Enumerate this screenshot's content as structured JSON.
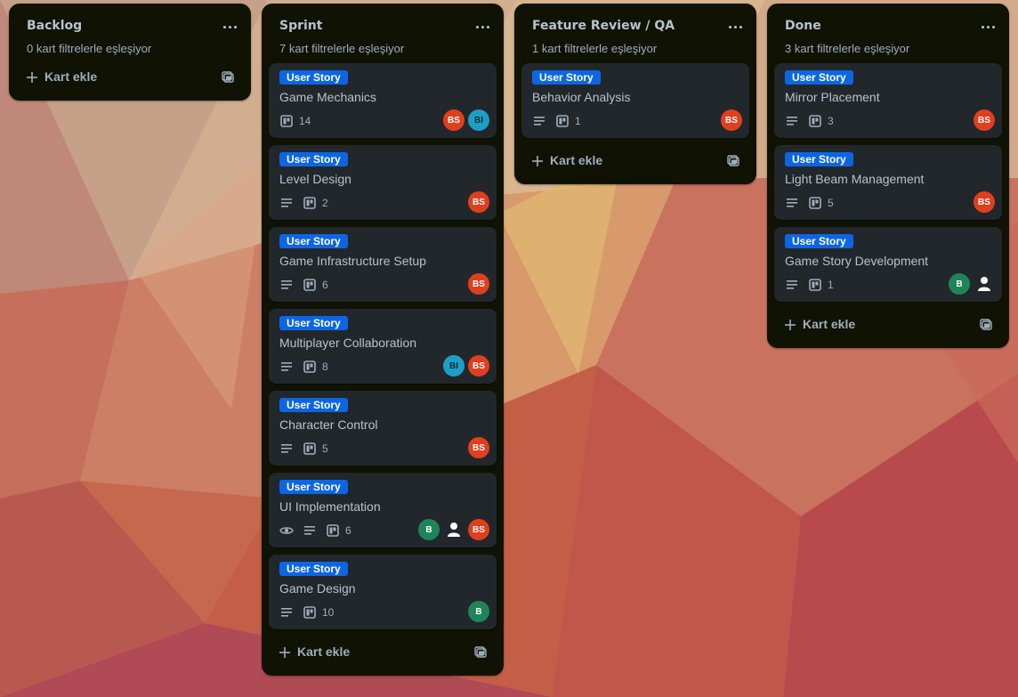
{
  "colors": {
    "list_bg": "#101204",
    "card_bg": "#22272b",
    "label_blue": "#0c66e4",
    "avatar_bs": "#e03f1e",
    "avatar_bi": "#1c9fc4",
    "avatar_b": "#1f845a"
  },
  "icons": {
    "menu": "more-horizontal-icon",
    "add": "plus-icon",
    "template": "card-template-icon",
    "description": "description-icon",
    "checklist": "checklist-icon",
    "watch": "eye-icon",
    "user": "user-icon"
  },
  "lists": [
    {
      "title": "Backlog",
      "subtitle": "0 kart filtrelerle eşleşiyor",
      "add_label": "Kart ekle",
      "cards": []
    },
    {
      "title": "Sprint",
      "subtitle": "7 kart filtrelerle eşleşiyor",
      "add_label": "Kart ekle",
      "cards": [
        {
          "label": "User Story",
          "title": "Game Mechanics",
          "watch": false,
          "description": false,
          "checklist": "14",
          "members": [
            "BS",
            "BI"
          ]
        },
        {
          "label": "User Story",
          "title": "Level Design",
          "watch": false,
          "description": true,
          "checklist": "2",
          "members": [
            "BS"
          ]
        },
        {
          "label": "User Story",
          "title": "Game Infrastructure Setup",
          "watch": false,
          "description": true,
          "checklist": "6",
          "members": [
            "BS"
          ]
        },
        {
          "label": "User Story",
          "title": "Multiplayer Collaboration",
          "watch": false,
          "description": true,
          "checklist": "8",
          "members": [
            "BI",
            "BS"
          ]
        },
        {
          "label": "User Story",
          "title": "Character Control",
          "watch": false,
          "description": true,
          "checklist": "5",
          "members": [
            "BS"
          ]
        },
        {
          "label": "User Story",
          "title": "UI Implementation",
          "watch": true,
          "description": true,
          "checklist": "6",
          "members": [
            "B",
            "user",
            "BS"
          ]
        },
        {
          "label": "User Story",
          "title": "Game Design",
          "watch": false,
          "description": true,
          "checklist": "10",
          "members": [
            "B"
          ]
        }
      ]
    },
    {
      "title": "Feature Review / QA",
      "subtitle": "1 kart filtrelerle eşleşiyor",
      "add_label": "Kart ekle",
      "cards": [
        {
          "label": "User Story",
          "title": "Behavior Analysis",
          "watch": false,
          "description": true,
          "checklist": "1",
          "members": [
            "BS"
          ]
        }
      ]
    },
    {
      "title": "Done",
      "subtitle": "3 kart filtrelerle eşleşiyor",
      "add_label": "Kart ekle",
      "cards": [
        {
          "label": "User Story",
          "title": "Mirror Placement",
          "watch": false,
          "description": true,
          "checklist": "3",
          "members": [
            "BS"
          ]
        },
        {
          "label": "User Story",
          "title": "Light Beam Management",
          "watch": false,
          "description": true,
          "checklist": "5",
          "members": [
            "BS"
          ]
        },
        {
          "label": "User Story",
          "title": "Game Story Development",
          "watch": false,
          "description": true,
          "checklist": "1",
          "members": [
            "B",
            "user"
          ]
        }
      ]
    }
  ]
}
